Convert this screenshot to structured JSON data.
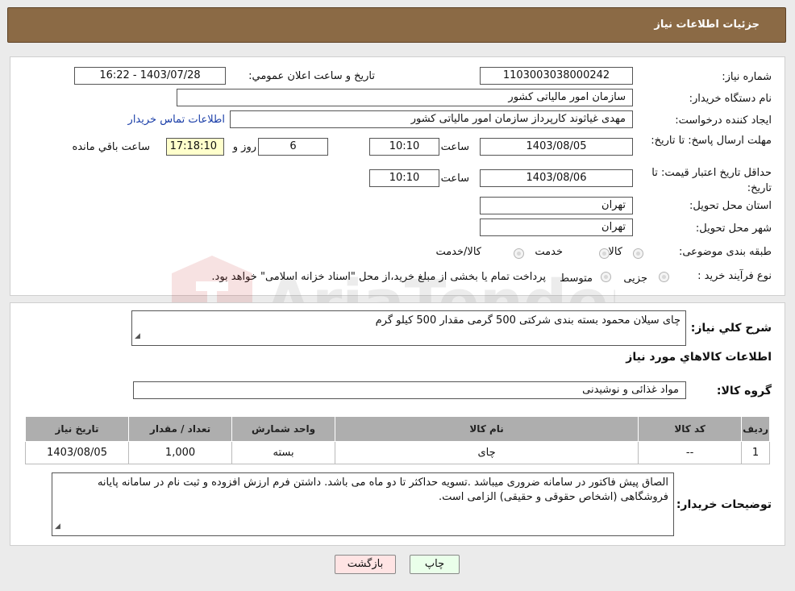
{
  "header": {
    "title": "جزئیات اطلاعات نیاز"
  },
  "form": {
    "need_number_label": "شماره نیاز:",
    "need_number": "1103003038000242",
    "announce_label": "تاریخ و ساعت اعلان عمومي:",
    "announce_value": "1403/07/28 - 16:22",
    "buyer_org_label": "نام دستگاه خریدار:",
    "buyer_org": "سازمان امور مالیاتی کشور",
    "creator_label": "ایجاد کننده درخواست:",
    "creator": "مهدی غیاثوند کارپرداز سازمان امور مالیاتی کشور",
    "contact_link": "اطلاعات تماس خریدار",
    "deadline_label": "مهلت ارسال پاسخ: تا تاریخ:",
    "deadline_date": "1403/08/05",
    "time_label": "ساعت",
    "deadline_time": "10:10",
    "days": "6",
    "days_label": "روز و",
    "remaining_time": "17:18:10",
    "remaining_label": "ساعت باقي مانده",
    "validity_label": "حداقل تاریخ اعتبار قیمت: تا تاریخ:",
    "validity_date": "1403/08/06",
    "validity_time": "10:10",
    "province_label": "استان محل تحویل:",
    "province": "تهران",
    "city_label": "شهر محل تحویل:",
    "city": "تهران",
    "category_label": "طبقه بندی موضوعی:",
    "category_options": [
      "کالا",
      "خدمت",
      "کالا/خدمت"
    ],
    "process_label": "نوع فرآیند خرید :",
    "process_options": [
      "جزیی",
      "متوسط"
    ],
    "process_note": "پرداخت تمام یا بخشی از مبلغ خرید،از محل \"اسناد خزانه اسلامی\" خواهد بود."
  },
  "details": {
    "description_label": "شرح کلي نیاز:",
    "description": "چای سیلان محمود بسته بندی شرکتی 500 گرمی مقدار 500 کیلو گرم",
    "items_heading": "اطلاعات کالاهاي مورد نیاز",
    "group_label": "گروه کالا:",
    "group": "مواد غذائی و نوشیدنی",
    "table": {
      "headers": [
        "ردیف",
        "کد کالا",
        "نام کالا",
        "واحد شمارش",
        "تعداد / مقدار",
        "تاریخ نیاز"
      ],
      "rows": [
        [
          "1",
          "--",
          "چای",
          "بسته",
          "1,000",
          "1403/08/05"
        ]
      ]
    },
    "buyer_notes_label": "توضیحات خریدار:",
    "buyer_notes": "الصاق پیش فاکتور در سامانه ضروری میباشد .تسویه حداکثر تا دو ماه می باشد.  داشتن فرم ارزش افزوده و ثبت نام در سامانه پایانه فروشگاهی (اشخاص حقوقی و حقیقی) الزامی است."
  },
  "buttons": {
    "print": "چاپ",
    "back": "بازگشت"
  },
  "watermark": {
    "text": "AriaTender.neT"
  },
  "colors": {
    "header_bg": "#8b6a45",
    "link": "#1a3ea8",
    "print_bg": "#eaffea",
    "back_bg": "#ffe4e4"
  }
}
